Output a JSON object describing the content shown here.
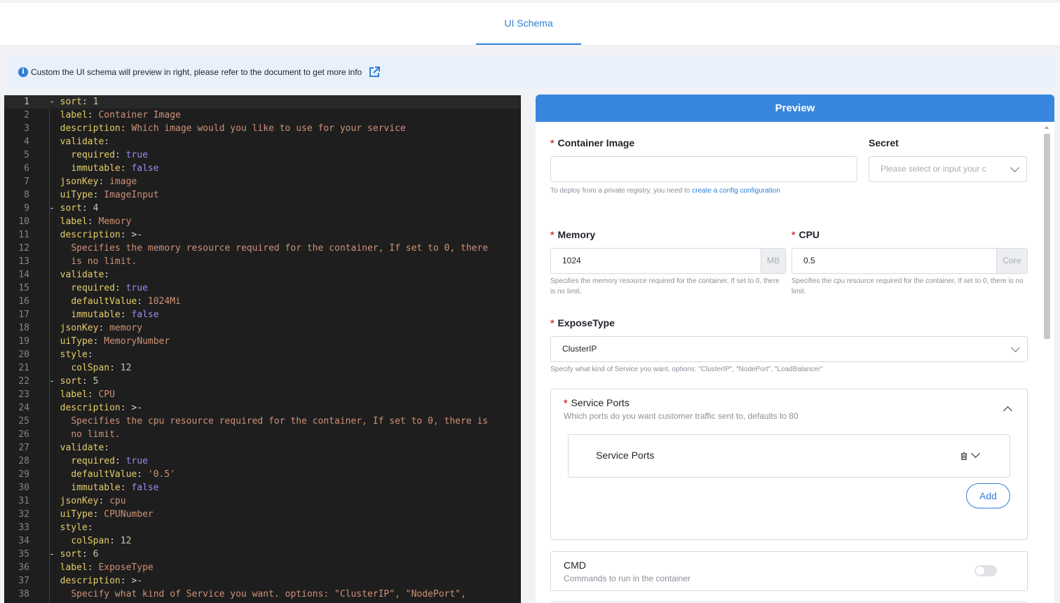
{
  "tabs": [
    {
      "label": "UI Schema",
      "active": true
    }
  ],
  "info": {
    "text": "Custom the UI schema will preview in right, please refer to the document to get more info",
    "icon": "info-icon",
    "link_icon": "external-link-icon"
  },
  "editor": {
    "current_line": 1,
    "lines": [
      [
        [
          "p",
          "- "
        ],
        [
          "k",
          "sort"
        ],
        [
          "p",
          ": "
        ],
        [
          "n",
          "1"
        ]
      ],
      [
        [
          "p",
          "  "
        ],
        [
          "k",
          "label"
        ],
        [
          "p",
          ": "
        ],
        [
          "v",
          "Container Image"
        ]
      ],
      [
        [
          "p",
          "  "
        ],
        [
          "k",
          "description"
        ],
        [
          "p",
          ": "
        ],
        [
          "v",
          "Which image would you like to use for your service"
        ]
      ],
      [
        [
          "p",
          "  "
        ],
        [
          "k",
          "validate"
        ],
        [
          "p",
          ":"
        ]
      ],
      [
        [
          "p",
          "    "
        ],
        [
          "k",
          "required"
        ],
        [
          "p",
          ": "
        ],
        [
          "b",
          "true"
        ]
      ],
      [
        [
          "p",
          "    "
        ],
        [
          "k",
          "immutable"
        ],
        [
          "p",
          ": "
        ],
        [
          "b",
          "false"
        ]
      ],
      [
        [
          "p",
          "  "
        ],
        [
          "k",
          "jsonKey"
        ],
        [
          "p",
          ": "
        ],
        [
          "v",
          "image"
        ]
      ],
      [
        [
          "p",
          "  "
        ],
        [
          "k",
          "uiType"
        ],
        [
          "p",
          ": "
        ],
        [
          "v",
          "ImageInput"
        ]
      ],
      [
        [
          "p",
          "- "
        ],
        [
          "k",
          "sort"
        ],
        [
          "p",
          ": "
        ],
        [
          "n",
          "4"
        ]
      ],
      [
        [
          "p",
          "  "
        ],
        [
          "k",
          "label"
        ],
        [
          "p",
          ": "
        ],
        [
          "v",
          "Memory"
        ]
      ],
      [
        [
          "p",
          "  "
        ],
        [
          "k",
          "description"
        ],
        [
          "p",
          ": >-"
        ]
      ],
      [
        [
          "p",
          "    "
        ],
        [
          "v",
          "Specifies the memory resource required for the container, If set to 0, there"
        ]
      ],
      [
        [
          "p",
          "    "
        ],
        [
          "v",
          "is no limit."
        ]
      ],
      [
        [
          "p",
          "  "
        ],
        [
          "k",
          "validate"
        ],
        [
          "p",
          ":"
        ]
      ],
      [
        [
          "p",
          "    "
        ],
        [
          "k",
          "required"
        ],
        [
          "p",
          ": "
        ],
        [
          "b",
          "true"
        ]
      ],
      [
        [
          "p",
          "    "
        ],
        [
          "k",
          "defaultValue"
        ],
        [
          "p",
          ": "
        ],
        [
          "v",
          "1024Mi"
        ]
      ],
      [
        [
          "p",
          "    "
        ],
        [
          "k",
          "immutable"
        ],
        [
          "p",
          ": "
        ],
        [
          "b",
          "false"
        ]
      ],
      [
        [
          "p",
          "  "
        ],
        [
          "k",
          "jsonKey"
        ],
        [
          "p",
          ": "
        ],
        [
          "v",
          "memory"
        ]
      ],
      [
        [
          "p",
          "  "
        ],
        [
          "k",
          "uiType"
        ],
        [
          "p",
          ": "
        ],
        [
          "v",
          "MemoryNumber"
        ]
      ],
      [
        [
          "p",
          "  "
        ],
        [
          "k",
          "style"
        ],
        [
          "p",
          ":"
        ]
      ],
      [
        [
          "p",
          "    "
        ],
        [
          "k",
          "colSpan"
        ],
        [
          "p",
          ": "
        ],
        [
          "n",
          "12"
        ]
      ],
      [
        [
          "p",
          "- "
        ],
        [
          "k",
          "sort"
        ],
        [
          "p",
          ": "
        ],
        [
          "n",
          "5"
        ]
      ],
      [
        [
          "p",
          "  "
        ],
        [
          "k",
          "label"
        ],
        [
          "p",
          ": "
        ],
        [
          "v",
          "CPU"
        ]
      ],
      [
        [
          "p",
          "  "
        ],
        [
          "k",
          "description"
        ],
        [
          "p",
          ": >-"
        ]
      ],
      [
        [
          "p",
          "    "
        ],
        [
          "v",
          "Specifies the cpu resource required for the container, If set to 0, there is"
        ]
      ],
      [
        [
          "p",
          "    "
        ],
        [
          "v",
          "no limit."
        ]
      ],
      [
        [
          "p",
          "  "
        ],
        [
          "k",
          "validate"
        ],
        [
          "p",
          ":"
        ]
      ],
      [
        [
          "p",
          "    "
        ],
        [
          "k",
          "required"
        ],
        [
          "p",
          ": "
        ],
        [
          "b",
          "true"
        ]
      ],
      [
        [
          "p",
          "    "
        ],
        [
          "k",
          "defaultValue"
        ],
        [
          "p",
          ": "
        ],
        [
          "v",
          "'0.5'"
        ]
      ],
      [
        [
          "p",
          "    "
        ],
        [
          "k",
          "immutable"
        ],
        [
          "p",
          ": "
        ],
        [
          "b",
          "false"
        ]
      ],
      [
        [
          "p",
          "  "
        ],
        [
          "k",
          "jsonKey"
        ],
        [
          "p",
          ": "
        ],
        [
          "v",
          "cpu"
        ]
      ],
      [
        [
          "p",
          "  "
        ],
        [
          "k",
          "uiType"
        ],
        [
          "p",
          ": "
        ],
        [
          "v",
          "CPUNumber"
        ]
      ],
      [
        [
          "p",
          "  "
        ],
        [
          "k",
          "style"
        ],
        [
          "p",
          ":"
        ]
      ],
      [
        [
          "p",
          "    "
        ],
        [
          "k",
          "colSpan"
        ],
        [
          "p",
          ": "
        ],
        [
          "n",
          "12"
        ]
      ],
      [
        [
          "p",
          "- "
        ],
        [
          "k",
          "sort"
        ],
        [
          "p",
          ": "
        ],
        [
          "n",
          "6"
        ]
      ],
      [
        [
          "p",
          "  "
        ],
        [
          "k",
          "label"
        ],
        [
          "p",
          ": "
        ],
        [
          "v",
          "ExposeType"
        ]
      ],
      [
        [
          "p",
          "  "
        ],
        [
          "k",
          "description"
        ],
        [
          "p",
          ": >-"
        ]
      ],
      [
        [
          "p",
          "    "
        ],
        [
          "v",
          "Specify what kind of Service you want. options: \"ClusterIP\", \"NodePort\","
        ]
      ]
    ]
  },
  "preview": {
    "title": "Preview",
    "container_image": {
      "label": "Container Image",
      "value": "",
      "help_prefix": "To deploy from a private registry, you need to ",
      "help_link": "create a config configuration"
    },
    "secret": {
      "label": "Secret",
      "placeholder": "Please select or input your c"
    },
    "memory": {
      "label": "Memory",
      "value": "1024",
      "unit": "MB",
      "help": "Specifies the memory resource required for the container, If set to 0, there is no limit."
    },
    "cpu": {
      "label": "CPU",
      "value": "0.5",
      "unit": "Core",
      "help": "Specifies the cpu resource required for the container, If set to 0, there is no limit."
    },
    "expose_type": {
      "label": "ExposeType",
      "value": "ClusterIP",
      "help": "Specify what kind of Service you want. options: \"ClusterIP\", \"NodePort\", \"LoadBalancer\""
    },
    "service_ports": {
      "title": "Service Ports",
      "subtitle": "Which ports do you want customer traffic sent to, defaults to 80",
      "item_title": "Service Ports",
      "add_label": "Add"
    },
    "cmd": {
      "title": "CMD",
      "subtitle": "Commands to run in the container",
      "enabled": false
    }
  },
  "colors": {
    "accent": "#2f7fd8",
    "header": "#3886dd",
    "required": "#d9363e",
    "editor_bg": "#1e1e1e"
  }
}
